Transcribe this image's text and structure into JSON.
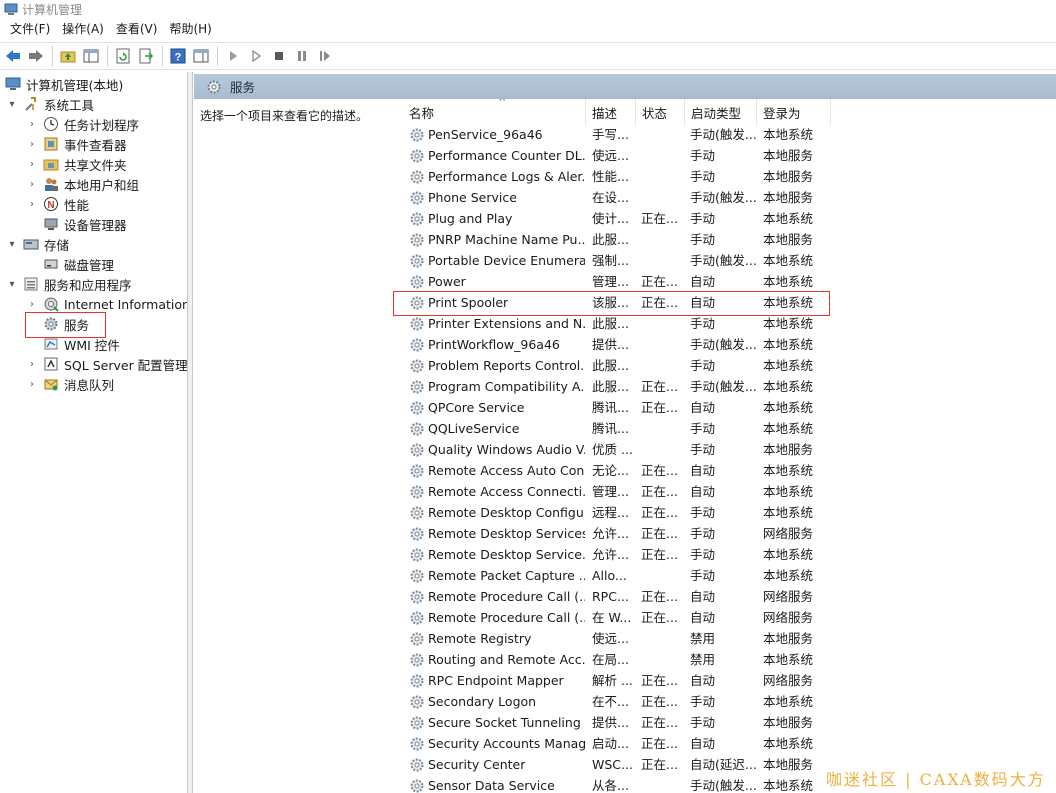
{
  "window": {
    "title": "计算机管理"
  },
  "menu": [
    "文件(F)",
    "操作(A)",
    "查看(V)",
    "帮助(H)"
  ],
  "toolbar": {
    "buttons": [
      "back-icon",
      "forward-icon",
      "up-folder-icon",
      "show-tree-icon",
      "refresh-icon",
      "export-icon",
      "help-icon",
      "properties-icon",
      "start-icon",
      "start-alt-icon",
      "stop-icon",
      "pause-icon",
      "restart-icon"
    ]
  },
  "tree": {
    "root": "计算机管理(本地)",
    "items": [
      {
        "label": "系统工具",
        "icon": "tools-icon"
      },
      {
        "label": "任务计划程序",
        "icon": "clock-icon"
      },
      {
        "label": "事件查看器",
        "icon": "event-viewer-icon"
      },
      {
        "label": "共享文件夹",
        "icon": "shared-folder-icon"
      },
      {
        "label": "本地用户和组",
        "icon": "users-icon"
      },
      {
        "label": "性能",
        "icon": "performance-icon"
      },
      {
        "label": "设备管理器",
        "icon": "device-manager-icon"
      },
      {
        "label": "存储",
        "icon": "storage-icon"
      },
      {
        "label": "磁盘管理",
        "icon": "disk-icon"
      },
      {
        "label": "服务和应用程序",
        "icon": "services-apps-icon"
      },
      {
        "label": "Internet Information S",
        "icon": "iis-icon"
      },
      {
        "label": "服务",
        "icon": "services-gear-icon"
      },
      {
        "label": "WMI 控件",
        "icon": "wmi-icon"
      },
      {
        "label": "SQL Server 配置管理器",
        "icon": "sql-icon"
      },
      {
        "label": "消息队列",
        "icon": "queue-icon"
      }
    ]
  },
  "pane_title": "服务",
  "description_hint": "选择一个项目来查看它的描述。",
  "columns": [
    "名称",
    "描述",
    "状态",
    "启动类型",
    "登录为"
  ],
  "services": [
    {
      "name": "PenService_96a46",
      "desc": "手写...",
      "status": "",
      "start": "手动(触发...",
      "logon": "本地系统"
    },
    {
      "name": "Performance Counter DL...",
      "desc": "使远...",
      "status": "",
      "start": "手动",
      "logon": "本地服务"
    },
    {
      "name": "Performance Logs & Aler...",
      "desc": "性能...",
      "status": "",
      "start": "手动",
      "logon": "本地服务"
    },
    {
      "name": "Phone Service",
      "desc": "在设...",
      "status": "",
      "start": "手动(触发...",
      "logon": "本地服务"
    },
    {
      "name": "Plug and Play",
      "desc": "使计...",
      "status": "正在...",
      "start": "手动",
      "logon": "本地系统"
    },
    {
      "name": "PNRP Machine Name Pu...",
      "desc": "此服...",
      "status": "",
      "start": "手动",
      "logon": "本地服务"
    },
    {
      "name": "Portable Device Enumera...",
      "desc": "强制...",
      "status": "",
      "start": "手动(触发...",
      "logon": "本地系统"
    },
    {
      "name": "Power",
      "desc": "管理...",
      "status": "正在...",
      "start": "自动",
      "logon": "本地系统"
    },
    {
      "name": "Print Spooler",
      "desc": "该服...",
      "status": "正在...",
      "start": "自动",
      "logon": "本地系统"
    },
    {
      "name": "Printer Extensions and N...",
      "desc": "此服...",
      "status": "",
      "start": "手动",
      "logon": "本地系统"
    },
    {
      "name": "PrintWorkflow_96a46",
      "desc": "提供...",
      "status": "",
      "start": "手动(触发...",
      "logon": "本地系统"
    },
    {
      "name": "Problem Reports Control...",
      "desc": "此服...",
      "status": "",
      "start": "手动",
      "logon": "本地系统"
    },
    {
      "name": "Program Compatibility A...",
      "desc": "此服...",
      "status": "正在...",
      "start": "手动(触发...",
      "logon": "本地系统"
    },
    {
      "name": "QPCore Service",
      "desc": "腾讯...",
      "status": "正在...",
      "start": "自动",
      "logon": "本地系统"
    },
    {
      "name": "QQLiveService",
      "desc": "腾讯...",
      "status": "",
      "start": "手动",
      "logon": "本地系统"
    },
    {
      "name": "Quality Windows Audio V...",
      "desc": "优质 ...",
      "status": "",
      "start": "手动",
      "logon": "本地服务"
    },
    {
      "name": "Remote Access Auto Con...",
      "desc": "无论...",
      "status": "正在...",
      "start": "自动",
      "logon": "本地系统"
    },
    {
      "name": "Remote Access Connecti...",
      "desc": "管理...",
      "status": "正在...",
      "start": "自动",
      "logon": "本地系统"
    },
    {
      "name": "Remote Desktop Configu...",
      "desc": "远程...",
      "status": "正在...",
      "start": "手动",
      "logon": "本地系统"
    },
    {
      "name": "Remote Desktop Services",
      "desc": "允许...",
      "status": "正在...",
      "start": "手动",
      "logon": "网络服务"
    },
    {
      "name": "Remote Desktop Service...",
      "desc": "允许...",
      "status": "正在...",
      "start": "手动",
      "logon": "本地系统"
    },
    {
      "name": "Remote Packet Capture ...",
      "desc": "Allo...",
      "status": "",
      "start": "手动",
      "logon": "本地系统"
    },
    {
      "name": "Remote Procedure Call (...",
      "desc": "RPC...",
      "status": "正在...",
      "start": "自动",
      "logon": "网络服务"
    },
    {
      "name": "Remote Procedure Call (...",
      "desc": "在 W...",
      "status": "正在...",
      "start": "自动",
      "logon": "网络服务"
    },
    {
      "name": "Remote Registry",
      "desc": "使远...",
      "status": "",
      "start": "禁用",
      "logon": "本地服务"
    },
    {
      "name": "Routing and Remote Acc...",
      "desc": "在局...",
      "status": "",
      "start": "禁用",
      "logon": "本地系统"
    },
    {
      "name": "RPC Endpoint Mapper",
      "desc": "解析 ...",
      "status": "正在...",
      "start": "自动",
      "logon": "网络服务"
    },
    {
      "name": "Secondary Logon",
      "desc": "在不...",
      "status": "正在...",
      "start": "手动",
      "logon": "本地系统"
    },
    {
      "name": "Secure Socket Tunneling ...",
      "desc": "提供...",
      "status": "正在...",
      "start": "手动",
      "logon": "本地服务"
    },
    {
      "name": "Security Accounts Manag...",
      "desc": "启动...",
      "status": "正在...",
      "start": "自动",
      "logon": "本地系统"
    },
    {
      "name": "Security Center",
      "desc": "WSC...",
      "status": "正在...",
      "start": "自动(延迟...",
      "logon": "本地服务"
    },
    {
      "name": "Sensor Data Service",
      "desc": "从各...",
      "status": "",
      "start": "手动(触发...",
      "logon": "本地系统"
    }
  ],
  "watermark": "咖迷社区 | CAXA数码大方",
  "colors": {
    "highlight": "#e3342f",
    "header_bar": "#adc0d4",
    "watermark": "#f0b040"
  }
}
